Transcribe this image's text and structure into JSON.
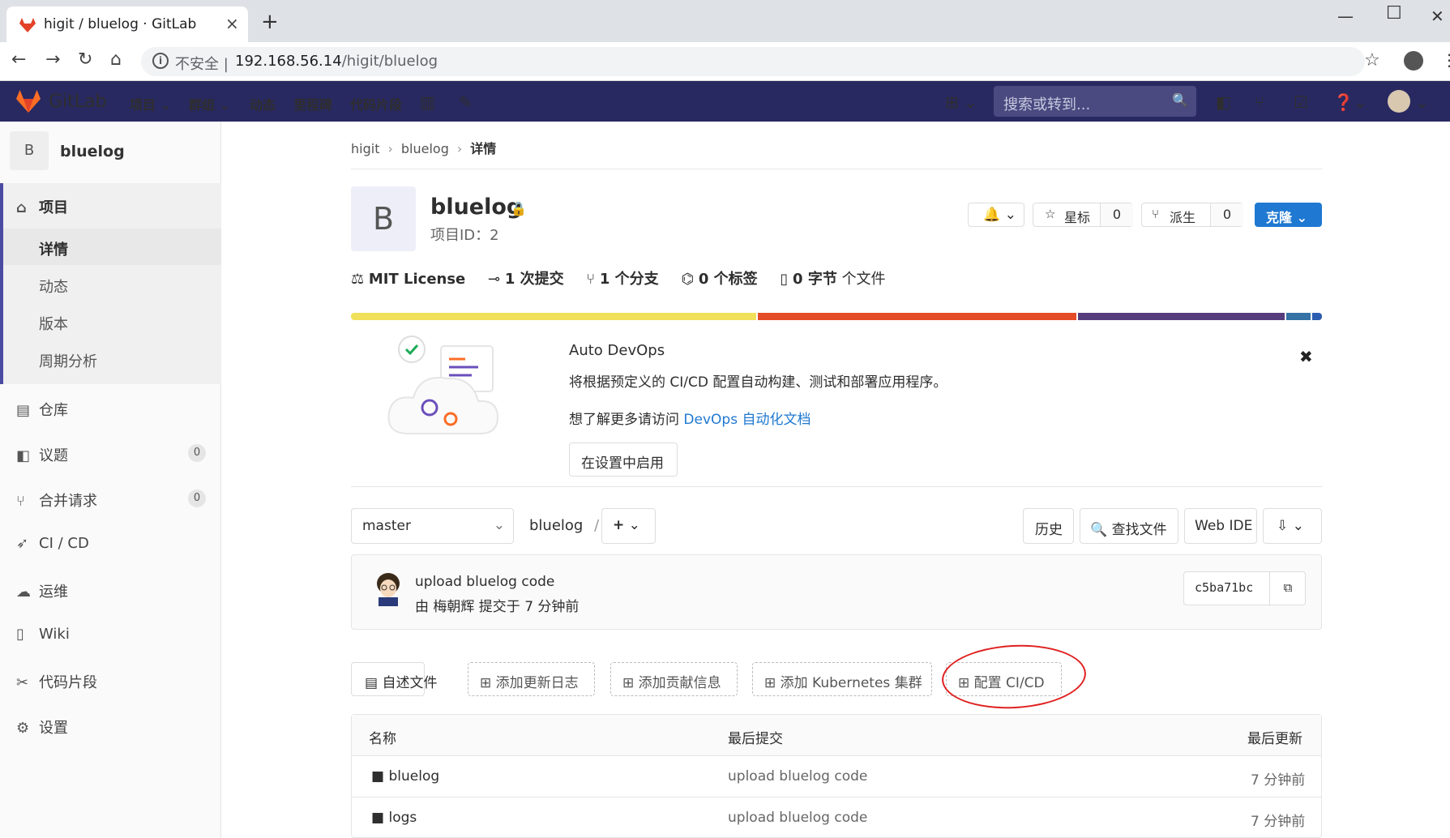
{
  "browser": {
    "tab_title": "higit / bluelog · GitLab",
    "tab_close": "×",
    "new_tab": "+",
    "security_label": "不安全",
    "url_host": "192.168.56.14",
    "url_path": "/higit/bluelog"
  },
  "navbar": {
    "brand": "GitLab",
    "items": [
      "项目 ⌄",
      "群组 ⌄",
      "动态",
      "里程碑",
      "代码片段"
    ],
    "search_placeholder": "搜索或转到..."
  },
  "sidebar": {
    "project_initial": "B",
    "project_name": "bluelog",
    "project_label": "项目",
    "sub_items": [
      "详情",
      "动态",
      "版本",
      "周期分析"
    ],
    "items": [
      {
        "label": "仓库",
        "badge": ""
      },
      {
        "label": "议题",
        "badge": "0"
      },
      {
        "label": "合并请求",
        "badge": "0"
      },
      {
        "label": "CI / CD",
        "badge": ""
      },
      {
        "label": "运维",
        "badge": ""
      },
      {
        "label": "Wiki",
        "badge": ""
      },
      {
        "label": "代码片段",
        "badge": ""
      },
      {
        "label": "设置",
        "badge": ""
      }
    ]
  },
  "breadcrumb": [
    "higit",
    "bluelog",
    "详情"
  ],
  "project": {
    "initial": "B",
    "name": "bluelog",
    "id_text": "项目ID：2",
    "star_label": "星标",
    "star_count": "0",
    "fork_label": "派生",
    "fork_count": "0",
    "clone_label": "克隆"
  },
  "stats": {
    "license": "MIT License",
    "commits": "1 次提交",
    "branches": "1 个分支",
    "tags": "0 个标签",
    "size": "0 字节",
    "size_suffix": "个文件"
  },
  "language_bar": [
    {
      "color": "#f1e05a",
      "percent": 42
    },
    {
      "color": "#e34c26",
      "percent": 33
    },
    {
      "color": "#563d7c",
      "percent": 21.5
    },
    {
      "color": "#3572a5",
      "percent": 2.5
    },
    {
      "color": "#2b5db0",
      "percent": 1
    }
  ],
  "devops": {
    "title": "Auto DevOps",
    "description": "将根据预定义的 CI/CD 配置自动构建、测试和部署应用程序。",
    "more_prefix": "想了解更多请访问 ",
    "more_link": "DevOps 自动化文档",
    "enable_button": "在设置中启用",
    "close": "✖"
  },
  "repo": {
    "branch": "master",
    "path": "bluelog",
    "path_sep": "/",
    "history": "历史",
    "find_file": "查找文件",
    "web_ide": "Web IDE"
  },
  "commit": {
    "message": "upload bluelog code",
    "author_line": "由 梅朝辉 提交于 7 分钟前",
    "sha": "c5ba71bc"
  },
  "action_buttons": {
    "readme": "自述文件",
    "changelog": "添加更新日志",
    "contributing": "添加贡献信息",
    "kubernetes": "添加 Kubernetes 集群",
    "cicd": "配置 CI/CD"
  },
  "table": {
    "headers": [
      "名称",
      "最后提交",
      "最后更新"
    ],
    "rows": [
      {
        "name": "bluelog",
        "commit": "upload bluelog code",
        "updated": "7 分钟前"
      },
      {
        "name": "logs",
        "commit": "upload bluelog code",
        "updated": "7 分钟前"
      }
    ]
  }
}
